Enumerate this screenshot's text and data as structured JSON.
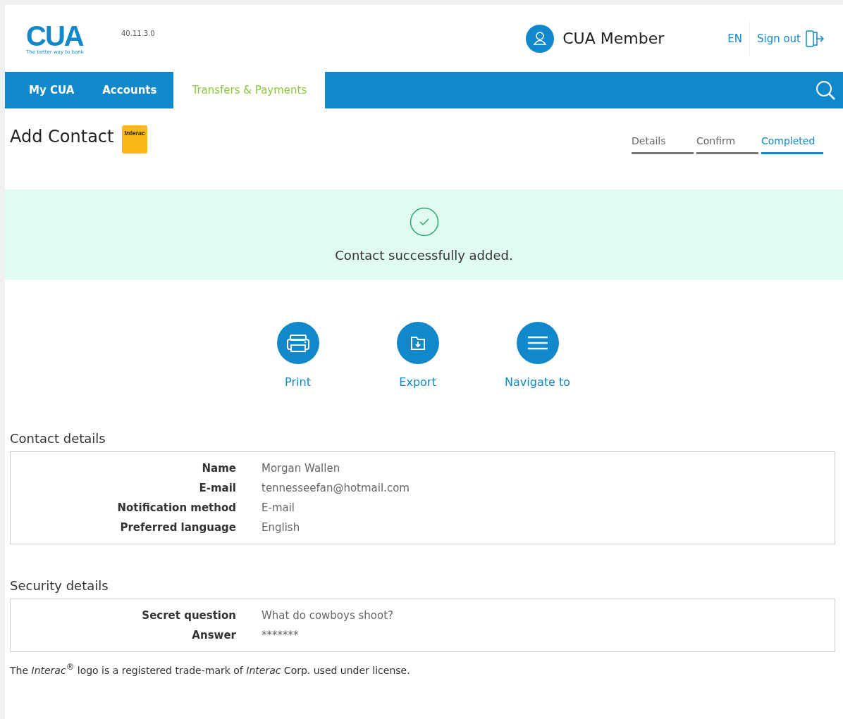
{
  "header": {
    "logo": {
      "text": "CUA",
      "tagline": "The better way to bank"
    },
    "version": "40.11.3.0",
    "user": "CUA Member",
    "language": "EN",
    "sign_out": "Sign out"
  },
  "nav": [
    {
      "label": "My CUA",
      "selected": false
    },
    {
      "label": "Accounts",
      "selected": false
    },
    {
      "label": "Transfers & Payments",
      "selected": true
    }
  ],
  "page": {
    "title": "Add Contact",
    "badge": "Interac"
  },
  "steps": [
    {
      "label": "Details",
      "selected": false
    },
    {
      "label": "Confirm",
      "selected": false
    },
    {
      "label": "Completed",
      "selected": true
    }
  ],
  "banner": {
    "message": "Contact successfully added."
  },
  "actions": [
    {
      "kind": "print",
      "label": "Print"
    },
    {
      "kind": "export",
      "label": "Export"
    },
    {
      "kind": "menu",
      "label": "Navigate to"
    }
  ],
  "sections": [
    {
      "title": "Contact details",
      "rows": [
        {
          "label": "Name",
          "value": "Morgan Wallen"
        },
        {
          "label": "E-mail",
          "value": "tennesseefan@hotmail.com"
        },
        {
          "label": "Notification method",
          "value": "E-mail"
        },
        {
          "label": "Preferred language",
          "value": "English"
        }
      ]
    },
    {
      "title": "Security details",
      "rows": [
        {
          "label": "Secret question",
          "value": "What do cowboys shoot?"
        },
        {
          "label": "Answer",
          "value": "*******"
        }
      ]
    }
  ],
  "footer": "The *Interac*$^{®}$ logo is a registered trade-mark of *Interac* Corp. used under license."
}
